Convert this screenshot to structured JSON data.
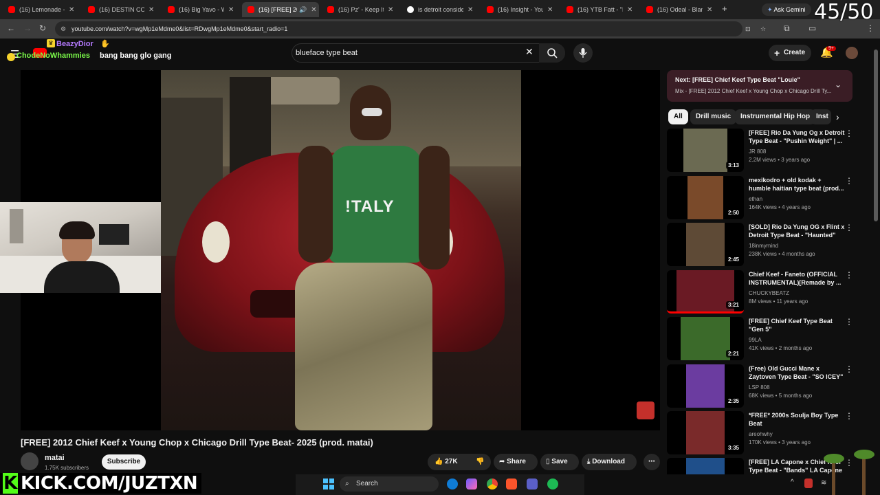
{
  "browser": {
    "tabs": [
      {
        "title": "(16) Lemonade - Yo",
        "x": 0
      },
      {
        "title": "(16) DESTIN CONR",
        "x": 0
      },
      {
        "title": "(16) Big Yavo - Wel",
        "x": 0
      },
      {
        "title": "(16) [FREE] 2012",
        "x": 0
      },
      {
        "title": "(16) Pz' - Keep It Tu",
        "x": 0
      },
      {
        "title": "is detroit conside",
        "x": 0
      },
      {
        "title": "(16) Insight - YouTu",
        "x": 0
      },
      {
        "title": "(16) YTB Fatt - \"Bac",
        "x": 0
      },
      {
        "title": "(16) Odeal - Blame",
        "x": 0
      }
    ],
    "new_tab": "+",
    "ask_gemini": "Ask Gemini",
    "url": "youtube.com/watch?v=wgMp1eMdme0&list=RDwgMp1eMdme0&start_radio=1"
  },
  "stream_overlay": {
    "counter": "45/50",
    "chat_user_1": "BeazyDior",
    "chat_user_2": "ChodeNoWhammies",
    "chat_message": "bang bang glo gang",
    "kick_prefix": "K",
    "kick_url": "KICK.COM/JUZTXN"
  },
  "youtube": {
    "search_query": "blueface type beat",
    "create_label": "Create",
    "notif_badge": "9+",
    "thumb_shirt_text": "!TALY",
    "video_title": "[FREE] 2012 Chief Keef x Young Chop x Chicago Drill Type Beat- 2025 (prod. matai)",
    "channel_name": "matai",
    "subscribers": "1.75K subscribers",
    "subscribe_label": "Subscribe",
    "likes": "27K",
    "share_label": "Share",
    "save_label": "Save",
    "download_label": "Download",
    "next_label": "Next:",
    "next_title": "[FREE] Chief Keef Type Beat \"Louie\"",
    "next_sub": "Mix - [FREE] 2012 Chief Keef x Young Chop x Chicago Drill Ty...",
    "chips": [
      "All",
      "Drill music",
      "Instrumental Hip Hop",
      "Inst"
    ],
    "recs": [
      {
        "title": "[FREE] Rio Da Yung Og x Detroit Type Beat - \"Pushin Weight\" | ...",
        "channel": "JR 808",
        "meta": "2.2M views • 3 years ago",
        "duration": "3:13",
        "color": "#6b6a52"
      },
      {
        "title": "mexikodro + old kodak + humble haitian type beat (prod...",
        "channel": "ethan",
        "meta": "164K views • 4 years ago",
        "duration": "2:50",
        "color": "#7a4a2a"
      },
      {
        "title": "[SOLD] Rio Da Yung OG x Flint x Detroit Type Beat - \"Haunted\"",
        "channel": "18inmymind",
        "meta": "238K views • 4 months ago",
        "duration": "2:45",
        "color": "#5e4a36"
      },
      {
        "title": "Chief Keef - Faneto (OFFICIAL INSTRUMENTAL)[Remade by ...",
        "channel": "CHUCKYBEATZ",
        "meta": "8M views • 11 years ago",
        "duration": "3:21",
        "color": "#6a1a24"
      },
      {
        "title": "[FREE] Chief Keef Type Beat \"Gen 5\"",
        "channel": "99LA",
        "meta": "41K views • 2 months ago",
        "duration": "2:21",
        "color": "#3b6a2a"
      },
      {
        "title": "(Free) Old Gucci Mane x Zaytoven Type Beat - \"SO ICEY\"",
        "channel": "LSP 808",
        "meta": "68K views • 5 months ago",
        "duration": "2:35",
        "color": "#6b3ca0"
      },
      {
        "title": "*FREE* 2000s Soulja Boy Type Beat",
        "channel": "areohwhy",
        "meta": "170K views • 3 years ago",
        "duration": "3:35",
        "color": "#7a2a2a"
      },
      {
        "title": "[FREE] LA Capone x Chief Keef Type Beat - \"Bands\" LA Capone",
        "channel": "",
        "meta": "",
        "duration": "",
        "color": "#1f4f8a"
      }
    ]
  },
  "taskbar": {
    "search_label": "Search"
  },
  "colors": {
    "youtube_red": "#ff0000",
    "kick_green": "#53fc18",
    "chat_gold": "#f6d32d",
    "chat_purple": "#b57aff",
    "chat_green": "#7cfc4a"
  }
}
